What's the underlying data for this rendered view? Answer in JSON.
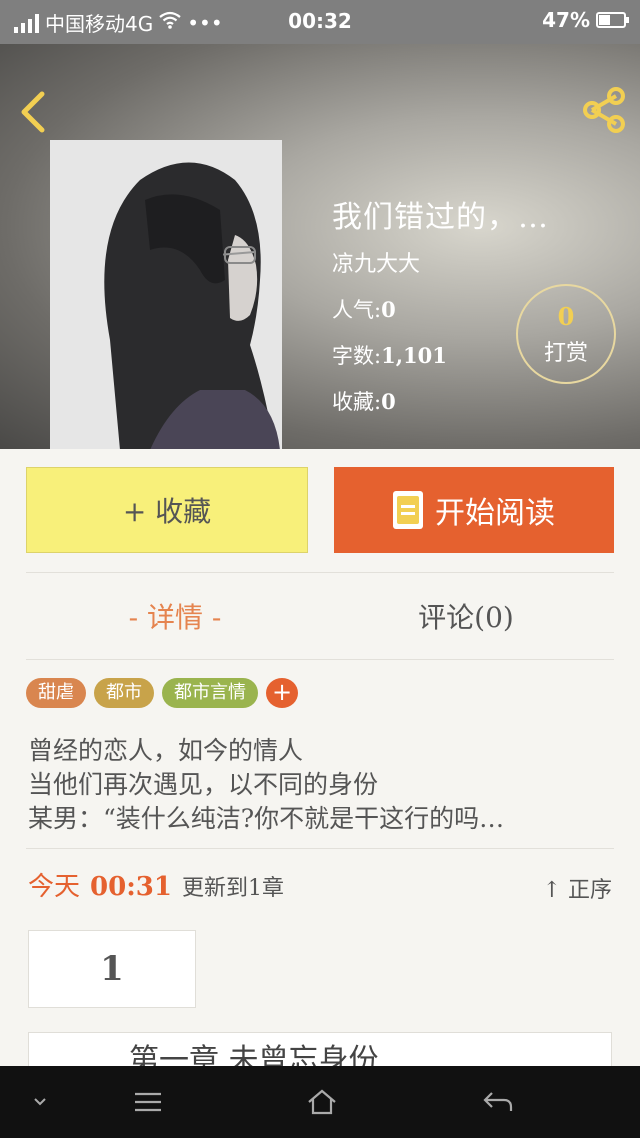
{
  "status_bar": {
    "carrier": "中国移动4G",
    "dots": "•••",
    "time": "00:32",
    "battery_percent": "47%",
    "battery_level": 0.47
  },
  "book": {
    "title": "我们错过的，…",
    "author": "凉九大大",
    "popularity_label": "人气:",
    "popularity_value": "0",
    "words_label": "字数:",
    "words_value": "1,101",
    "favorites_label": "收藏:",
    "favorites_value": "0"
  },
  "reward": {
    "count": "0",
    "label": "打赏"
  },
  "actions": {
    "collect_label": "+ 收藏",
    "read_label": "开始阅读"
  },
  "tabs": {
    "detail": "- 详情 -",
    "comments": "评论(0)"
  },
  "tags": [
    {
      "label": "甜虐",
      "color": "#d9864f"
    },
    {
      "label": "都市",
      "color": "#c8a34a"
    },
    {
      "label": "都市言情",
      "color": "#9ab44e"
    }
  ],
  "tag_add": "+",
  "description": [
    "曾经的恋人，如今的情人",
    "当他们再次遇见，以不同的身份",
    "某男：“装什么纯洁?你不就是干这行的吗…"
  ],
  "update": {
    "today": "今天",
    "time": "00:31",
    "info": "更新到1章",
    "sort": "↑ 正序"
  },
  "chapters": {
    "first_number": "1",
    "next_title": "第一章 未曾忘身份"
  },
  "colors": {
    "accent": "#e5612f",
    "collect": "#f8f07a",
    "gold": "#f2cf52"
  }
}
